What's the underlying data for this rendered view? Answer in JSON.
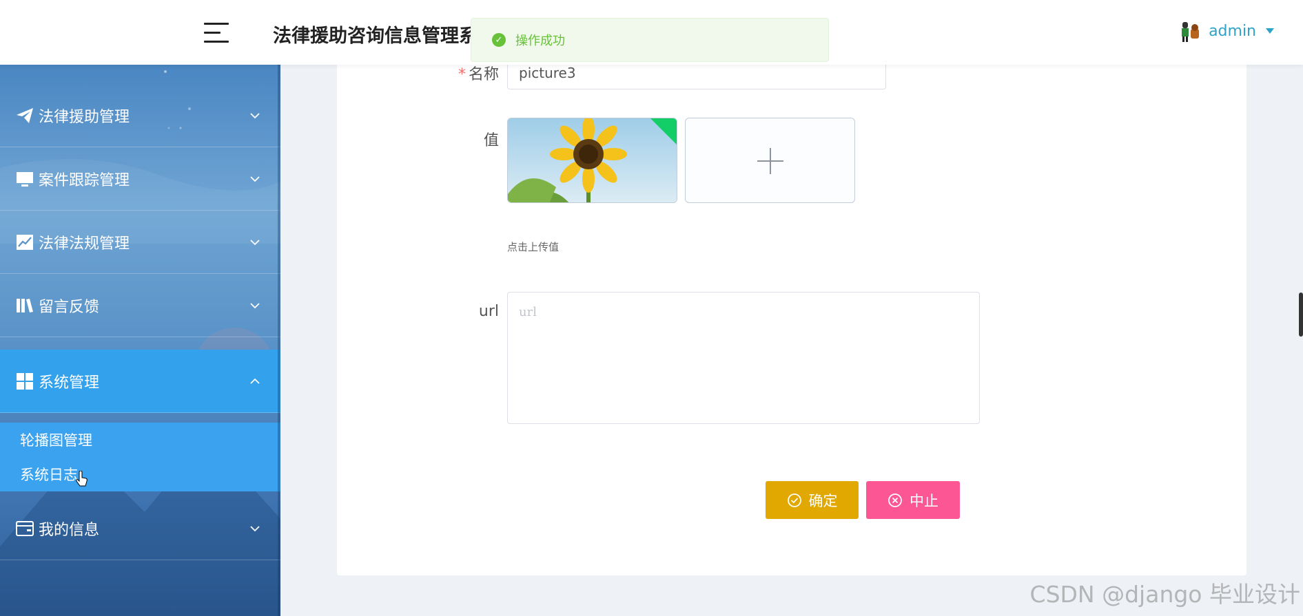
{
  "header": {
    "app_title": "法律援助咨询信息管理系统",
    "user_name": "admin"
  },
  "toast": {
    "message": "操作成功",
    "type": "success"
  },
  "sidebar": {
    "items": [
      {
        "label": "法律援助管理",
        "icon": "paper-plane-icon",
        "expanded": false
      },
      {
        "label": "案件跟踪管理",
        "icon": "monitor-icon",
        "expanded": false
      },
      {
        "label": "法律法规管理",
        "icon": "line-chart-icon",
        "expanded": false
      },
      {
        "label": "留言反馈",
        "icon": "books-icon",
        "expanded": false
      },
      {
        "label": "系统管理",
        "icon": "grid-icon",
        "expanded": true
      },
      {
        "label": "我的信息",
        "icon": "id-card-icon",
        "expanded": false
      }
    ],
    "submenu": [
      {
        "label": "轮播图管理"
      },
      {
        "label": "系统日志"
      }
    ]
  },
  "form": {
    "name_label": "名称",
    "name_required_mark": "*",
    "name_value": "picture3",
    "value_label": "值",
    "upload_tip": "点击上传值",
    "url_label": "url",
    "url_placeholder": "url",
    "url_value": "",
    "confirm_label": "确定",
    "stop_label": "中止"
  },
  "watermark": "CSDN @django 毕业设计",
  "colors": {
    "accent": "#33a1ec",
    "confirm": "#e0a800",
    "stop": "#fc5694",
    "success": "#67c23a",
    "username": "#2ea3c7"
  }
}
